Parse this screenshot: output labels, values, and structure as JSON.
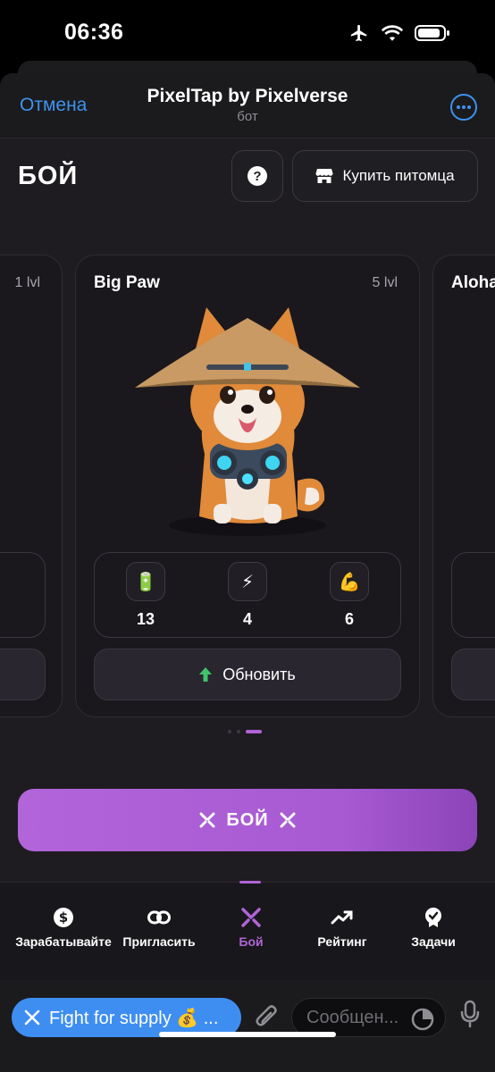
{
  "status_bar": {
    "time": "06:36"
  },
  "header": {
    "cancel_label": "Отмена",
    "title": "PixelTap by Pixelverse",
    "subtitle": "бот"
  },
  "app": {
    "page_title": "БОЙ",
    "help_label": "?",
    "buy_pet_label": "Купить питомца"
  },
  "cards": {
    "left": {
      "level": "1 lvl"
    },
    "main": {
      "name": "Big Paw",
      "level": "5 lvl",
      "stats": [
        {
          "icon": "battery-icon",
          "value": "13"
        },
        {
          "icon": "lightning-icon",
          "value": "4"
        },
        {
          "icon": "flexed-biceps-icon",
          "value": "6"
        }
      ],
      "upgrade_label": "Обновить"
    },
    "right": {
      "name": "Aloha"
    }
  },
  "carousel": {
    "pages": 3,
    "active_index": 2
  },
  "fight_button_label": "БОЙ",
  "tabs": [
    {
      "label": "Зарабатывайте",
      "icon": "dollar-coin-icon",
      "active": false
    },
    {
      "label": "Пригласить",
      "icon": "link-icon",
      "active": false
    },
    {
      "label": "Бой",
      "icon": "crossed-swords-icon",
      "active": true
    },
    {
      "label": "Рейтинг",
      "icon": "trending-up-icon",
      "active": false
    },
    {
      "label": "Задачи",
      "icon": "badge-icon",
      "active": false
    }
  ],
  "composer": {
    "bot_chip_label": "Fight for supply 💰 ...",
    "message_placeholder": "Сообщен..."
  },
  "colors": {
    "accent_purple": "#b064d6",
    "telegram_blue": "#3e8ef2",
    "background": "#1e1c20"
  }
}
